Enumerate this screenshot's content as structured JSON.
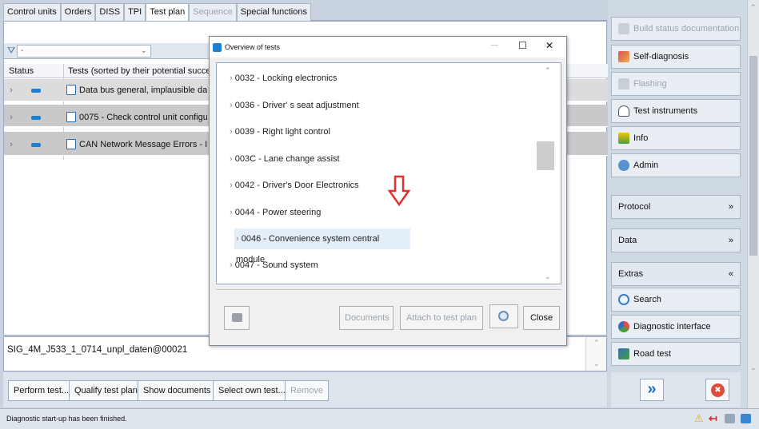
{
  "tabs": [
    {
      "label": "Control units",
      "state": "normal"
    },
    {
      "label": "Orders",
      "state": "normal"
    },
    {
      "label": "DISS",
      "state": "normal"
    },
    {
      "label": "TPI",
      "state": "normal"
    },
    {
      "label": "Test plan",
      "state": "active"
    },
    {
      "label": "Sequence",
      "state": "disabled"
    },
    {
      "label": "Special functions",
      "state": "normal"
    }
  ],
  "filter": {
    "value": "-"
  },
  "table": {
    "headers": {
      "status": "Status",
      "tests": "Tests (sorted by their potential succe"
    },
    "rows": [
      {
        "text": "Data bus general, implausible dat"
      },
      {
        "text": "0075 - Check control unit configu"
      },
      {
        "text": "CAN Network Message Errors - I"
      }
    ]
  },
  "sig_text": "SIG_4M_J533_1_0714_unpl_daten@00021",
  "bottom_buttons": [
    {
      "label": "Perform test...",
      "enabled": true
    },
    {
      "label": "Qualify test plan",
      "enabled": true
    },
    {
      "label": "Show documents",
      "enabled": true
    },
    {
      "label": "Select own test...",
      "enabled": true
    },
    {
      "label": "Remove",
      "enabled": false
    }
  ],
  "status_text": "Diagnostic start-up has been finished.",
  "right_panel": {
    "buttons": [
      {
        "label": "Build status documentation",
        "enabled": false,
        "icon": "document-icon"
      },
      {
        "label": "Self-diagnosis",
        "enabled": true,
        "icon": "self-diagnosis-icon"
      },
      {
        "label": "Flashing",
        "enabled": false,
        "icon": "flashing-icon"
      },
      {
        "label": "Test instruments",
        "enabled": true,
        "icon": "gauge-icon"
      },
      {
        "label": "Info",
        "enabled": true,
        "icon": "info-icon"
      },
      {
        "label": "Admin",
        "enabled": true,
        "icon": "admin-icon"
      }
    ],
    "sections": [
      {
        "label": "Protocol",
        "chevron": "»"
      },
      {
        "label": "Data",
        "chevron": "»"
      },
      {
        "label": "Extras",
        "chevron": "«"
      }
    ],
    "extras": [
      {
        "label": "Search",
        "icon": "search-icon"
      },
      {
        "label": "Diagnostic interface",
        "icon": "diagnostic-interface-icon"
      },
      {
        "label": "Road test",
        "icon": "road-test-icon"
      }
    ],
    "forward_glyph": "»",
    "close_glyph": "✖"
  },
  "dialog": {
    "title": "Overview of tests",
    "window_controls": {
      "minimize": "—",
      "maximize": "☐",
      "close": "✕"
    },
    "items": [
      {
        "label": "0032 - Locking electronics",
        "selected": false
      },
      {
        "label": "0036 - Driver' s seat adjustment",
        "selected": false
      },
      {
        "label": "0039 - Right light control",
        "selected": false
      },
      {
        "label": "003C - Lane change assist",
        "selected": false
      },
      {
        "label": "0042 - Driver's Door Electronics",
        "selected": false
      },
      {
        "label": "0044 - Power steering",
        "selected": false
      },
      {
        "label": "0046 - Convenience system central module",
        "selected": true
      },
      {
        "label": "0047 - Sound system",
        "selected": false
      }
    ],
    "item_chevron": "›",
    "buttons": {
      "documents": "Documents",
      "attach": "Attach to test plan",
      "close": "Close"
    },
    "annotation_arrow_color": "#e03030"
  },
  "colors": {
    "accent": "#1c7fd1",
    "selected_row": "#dcdcdc"
  }
}
